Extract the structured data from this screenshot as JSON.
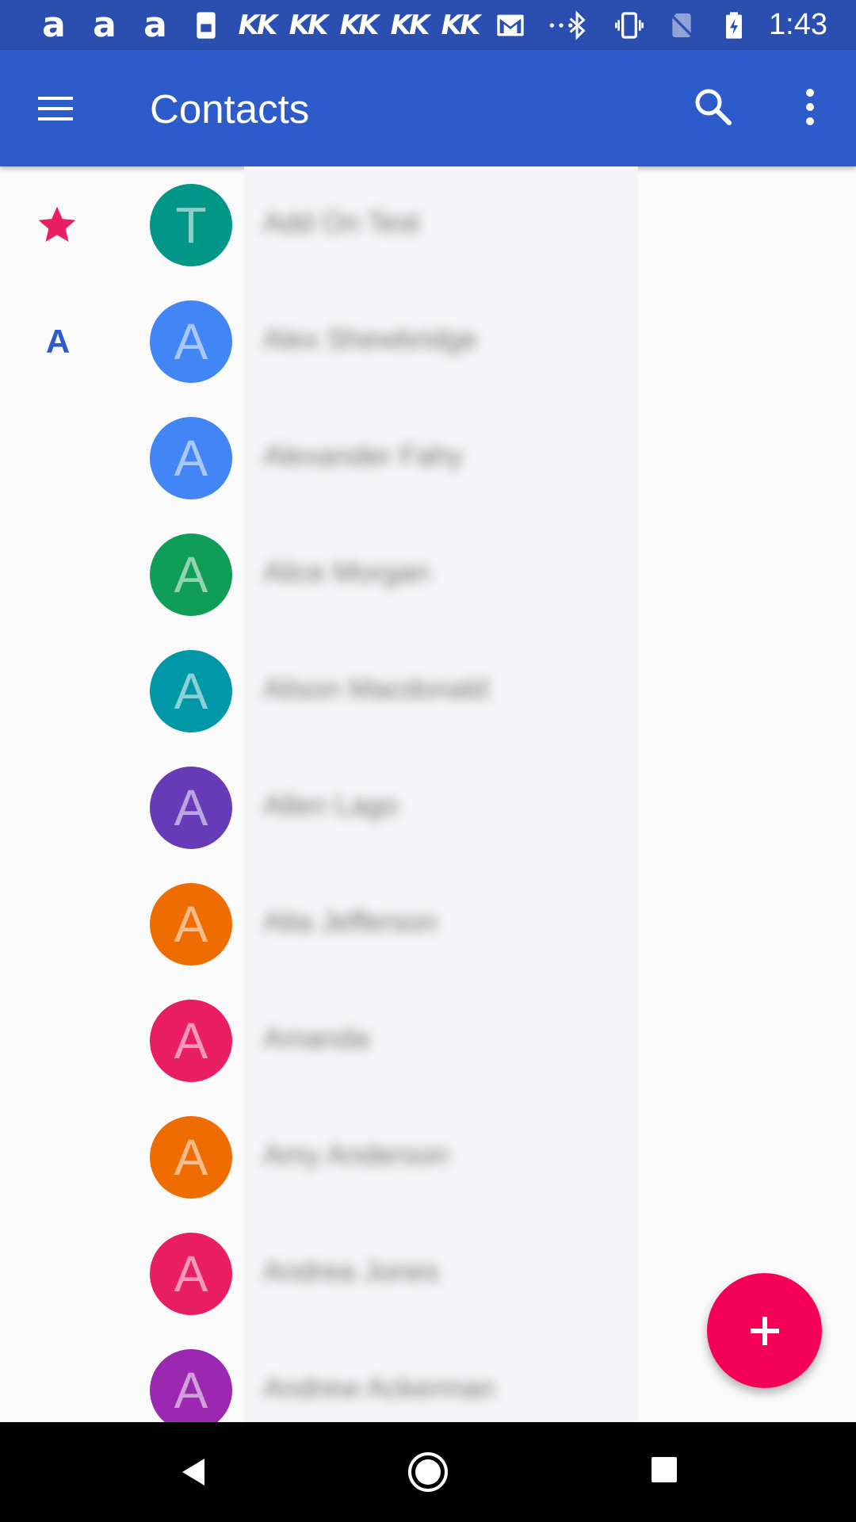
{
  "status_bar": {
    "left_icons": [
      "amazon-icon",
      "amazon-icon",
      "amazon-icon",
      "sim-toolkit-icon",
      "kk-icon",
      "kk-icon",
      "kk-icon",
      "kk-icon",
      "kk-icon",
      "gmail-icon",
      "more-notifications-icon"
    ],
    "kk_text": "KK",
    "amazon_text": "a",
    "right_icons": [
      "bluetooth-icon",
      "vibrate-icon",
      "no-sim-icon",
      "battery-charging-icon"
    ],
    "time": "1:43"
  },
  "app_bar": {
    "title": "Contacts",
    "menu_icon": "hamburger-menu-icon",
    "search_icon": "search-icon",
    "more_icon": "more-vert-icon",
    "color": "#2D5BCA"
  },
  "contacts": [
    {
      "section": "star",
      "initial": "T",
      "color": "#009688",
      "name": "Add On Test"
    },
    {
      "section": "A",
      "initial": "A",
      "color": "#4285F4",
      "name": "Alex Shewbridge"
    },
    {
      "section": "",
      "initial": "A",
      "color": "#4285F4",
      "name": "Alexander Fahy"
    },
    {
      "section": "",
      "initial": "A",
      "color": "#0F9D58",
      "name": "Alice Morgan"
    },
    {
      "section": "",
      "initial": "A",
      "color": "#0097A7",
      "name": "Alison Macdonald"
    },
    {
      "section": "",
      "initial": "A",
      "color": "#673AB7",
      "name": "Allen Lago"
    },
    {
      "section": "",
      "initial": "A",
      "color": "#EF6C00",
      "name": "Alta Jefferson"
    },
    {
      "section": "",
      "initial": "A",
      "color": "#E91E63",
      "name": "Amanda"
    },
    {
      "section": "",
      "initial": "A",
      "color": "#EF6C00",
      "name": "Amy Anderson"
    },
    {
      "section": "",
      "initial": "A",
      "color": "#E91E63",
      "name": "Andrea Jones"
    },
    {
      "section": "",
      "initial": "A",
      "color": "#9C27B0",
      "name": "Andrew Ackerman"
    }
  ],
  "fab": {
    "icon": "add-icon",
    "color": "#F50057"
  },
  "nav_bar": {
    "back_icon": "back-icon",
    "home_icon": "home-icon",
    "recents_icon": "recents-icon"
  }
}
